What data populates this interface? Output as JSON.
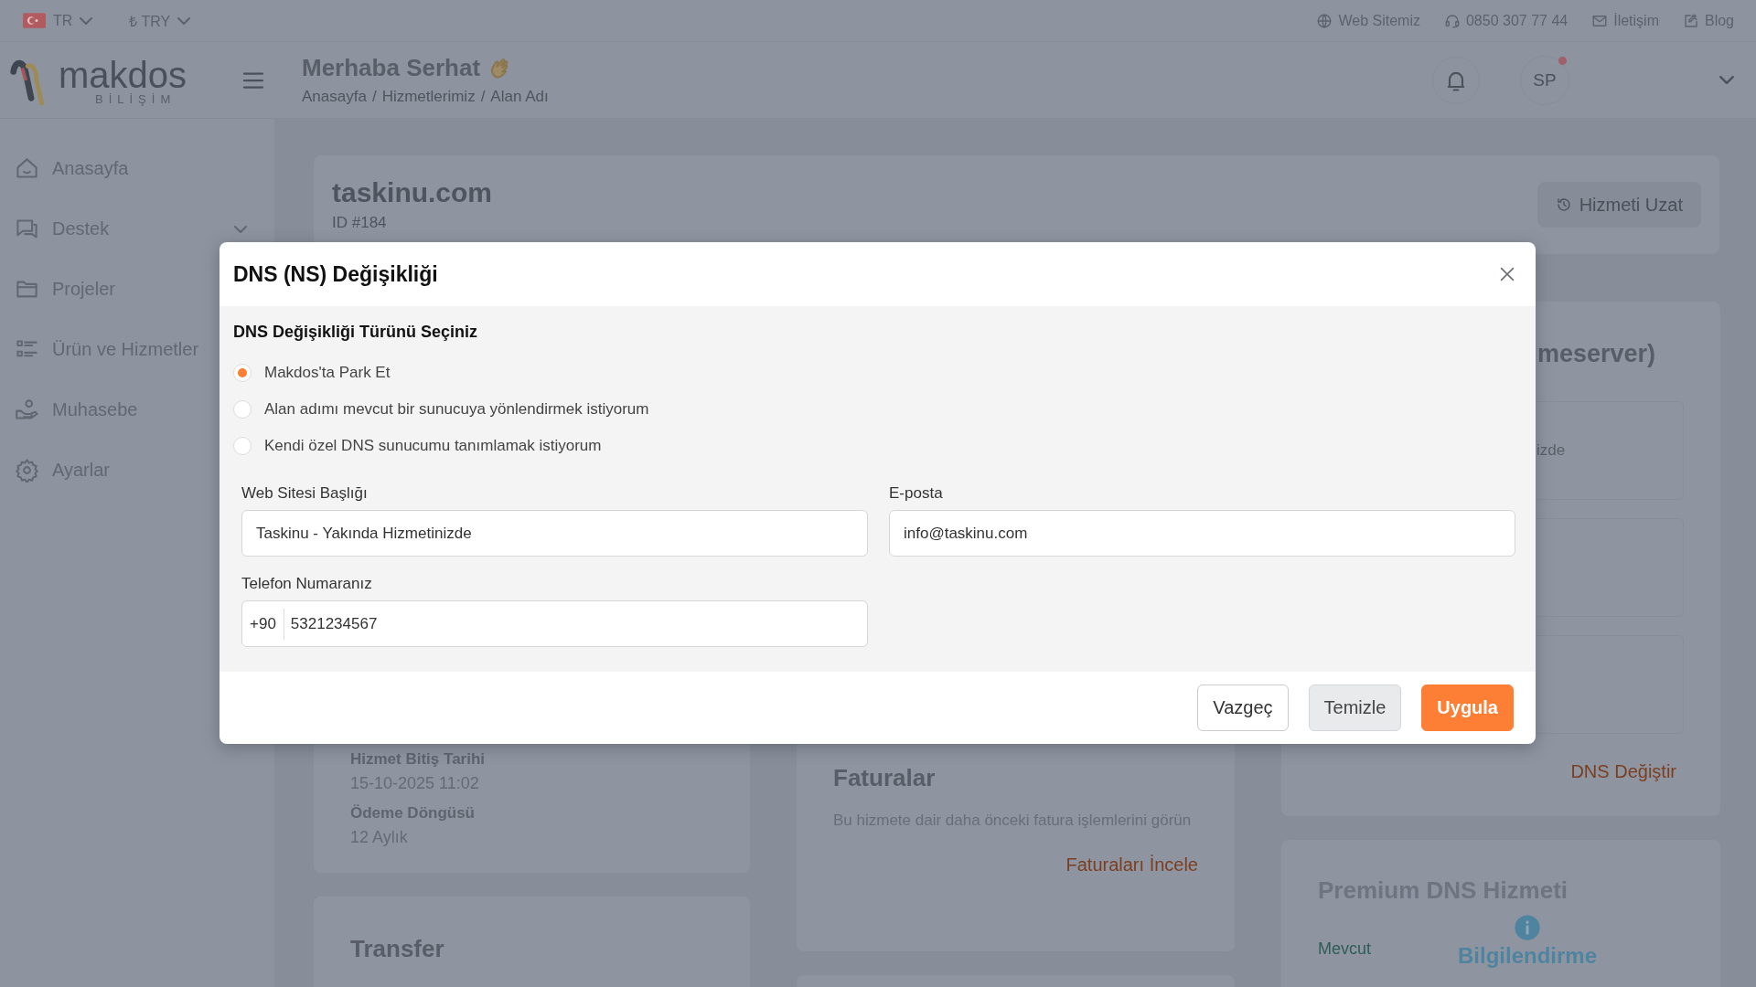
{
  "top_bar": {
    "language": "TR",
    "currency": "₺ TRY",
    "links": [
      {
        "kind": "globe",
        "label": "Web Sitemiz"
      },
      {
        "kind": "headset",
        "label": "0850 307 77 44"
      },
      {
        "kind": "mail",
        "label": "İletişim"
      },
      {
        "kind": "edit",
        "label": "Blog"
      }
    ]
  },
  "header": {
    "logo": {
      "name": "makdos",
      "tagline": "BİLİŞİM"
    },
    "greeting": "Merhaba Serhat",
    "breadcrumb": {
      "separator": "/",
      "items": [
        "Anasayfa",
        "Hizmetlerimiz",
        "Alan Adı"
      ]
    },
    "avatar": {
      "initials": "SP",
      "notification": true
    }
  },
  "sidebar": {
    "items": [
      {
        "label": "Anasayfa",
        "kind": "link"
      },
      {
        "label": "Destek",
        "kind": "group"
      },
      {
        "label": "Projeler",
        "kind": "link"
      },
      {
        "label": "Ürün ve Hizmetler",
        "kind": "link"
      },
      {
        "label": "Muhasebe",
        "kind": "link"
      },
      {
        "label": "Ayarlar",
        "kind": "link"
      }
    ]
  },
  "service": {
    "title": "taskinu.com",
    "id": "ID #184",
    "extend_button": "Hizmeti Uzat"
  },
  "details": [
    {
      "label": "Hizmet Bitiş Tarihi",
      "value": "15-10-2025 11:02"
    },
    {
      "label": "Ödeme Döngüsü",
      "value": "12 Aylık"
    }
  ],
  "transfer": {
    "title": "Transfer"
  },
  "invoices": {
    "title": "Faturalar",
    "text": "Bu hizmete dair daha önceki fatura işlemlerini görün",
    "link": "Faturaları İncele"
  },
  "nameserver": {
    "title": "meserver)",
    "fragment": "izde",
    "link": "DNS Değiştir"
  },
  "premium": {
    "title": "Premium DNS Hizmeti",
    "status": "Mevcut",
    "notice_title": "Bilgilendirme"
  },
  "modal": {
    "title": "DNS (NS) Değişikliği",
    "section_title": "DNS Değişikliği Türünü Seçiniz",
    "options": [
      {
        "label": "Makdos'ta Park Et",
        "selected": true
      },
      {
        "label": "Alan adımı mevcut bir sunucuya yönlendirmek istiyorum",
        "selected": false
      },
      {
        "label": "Kendi özel DNS sunucumu tanımlamak istiyorum",
        "selected": false
      }
    ],
    "fields": [
      {
        "label": "Web Sitesi Başlığı",
        "value": "Taskinu - Yakında Hizmetinizde"
      },
      {
        "label": "E-posta",
        "value": "info@taskinu.com"
      },
      {
        "label": "Telefon Numaranız",
        "prefix": "+90",
        "value": "5321234567"
      }
    ],
    "buttons": [
      {
        "label": "Vazgeç",
        "kind": "outline"
      },
      {
        "label": "Temizle",
        "kind": "secondary"
      },
      {
        "label": "Uygula",
        "kind": "primary"
      }
    ]
  }
}
